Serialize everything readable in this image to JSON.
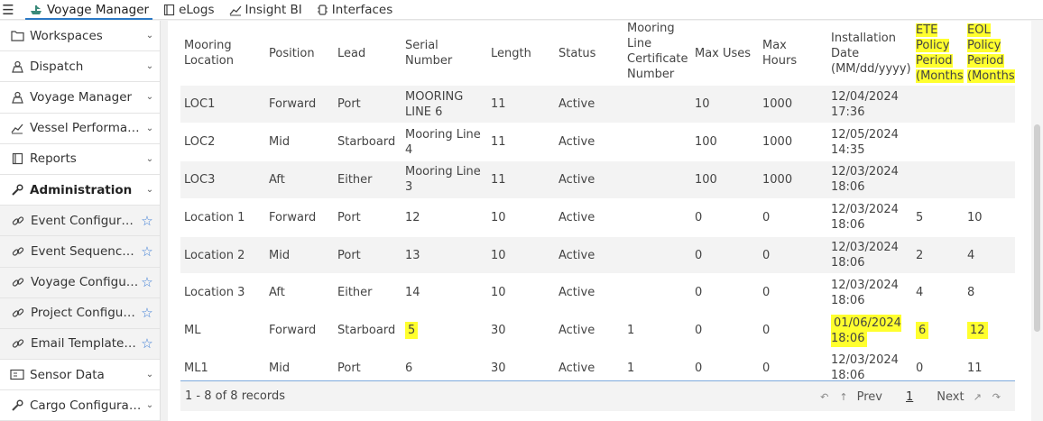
{
  "topbar": {
    "tabs": [
      {
        "label": "Voyage Manager",
        "icon": "ship-icon"
      },
      {
        "label": "eLogs",
        "icon": "book-icon"
      },
      {
        "label": "Insight BI",
        "icon": "chart-icon"
      },
      {
        "label": "Interfaces",
        "icon": "interfaces-icon"
      }
    ]
  },
  "sidebar": {
    "items": [
      {
        "label": "Workspaces"
      },
      {
        "label": "Dispatch"
      },
      {
        "label": "Voyage Manager"
      },
      {
        "label": "Vessel Performance"
      },
      {
        "label": "Reports"
      },
      {
        "label": "Administration"
      },
      {
        "label": "Event Configuration"
      },
      {
        "label": "Event Sequence Configuration"
      },
      {
        "label": "Voyage Configuration"
      },
      {
        "label": "Project Configuration"
      },
      {
        "label": "Email Template Configuration"
      },
      {
        "label": "Sensor Data"
      },
      {
        "label": "Cargo Configuration"
      }
    ]
  },
  "table": {
    "columns": [
      "Mooring Location",
      "Position",
      "Lead",
      "Serial Number",
      "Length",
      "Status",
      "Mooring Line Certificate Number",
      "Max Uses",
      "Max Hours",
      "Installation Date (MM/dd/yyyy)",
      "ETE Policy Period (Months)",
      "EOL Policy Period (Months)"
    ],
    "rows": [
      [
        "LOC1",
        "Forward",
        "Port",
        "MOORING LINE 6",
        "11",
        "Active",
        "",
        "10",
        "1000",
        "12/04/2024 17:36",
        "",
        ""
      ],
      [
        "LOC2",
        "Mid",
        "Starboard",
        "Mooring Line 4",
        "11",
        "Active",
        "",
        "100",
        "1000",
        "12/05/2024 14:35",
        "",
        ""
      ],
      [
        "LOC3",
        "Aft",
        "Either",
        "Mooring Line 3",
        "11",
        "Active",
        "",
        "100",
        "1000",
        "12/03/2024 18:06",
        "",
        ""
      ],
      [
        "Location 1",
        "Forward",
        "Port",
        "12",
        "10",
        "Active",
        "",
        "0",
        "0",
        "12/03/2024 18:06",
        "5",
        "10"
      ],
      [
        "Location 2",
        "Mid",
        "Port",
        "13",
        "10",
        "Active",
        "",
        "0",
        "0",
        "12/03/2024 18:06",
        "2",
        "4"
      ],
      [
        "Location 3",
        "Aft",
        "Either",
        "14",
        "10",
        "Active",
        "",
        "0",
        "0",
        "12/03/2024 18:06",
        "4",
        "8"
      ],
      [
        "ML",
        "Forward",
        "Starboard",
        "5",
        "30",
        "Active",
        "1",
        "0",
        "0",
        "01/06/2024 18:06",
        "6",
        "12"
      ],
      [
        "ML1",
        "Mid",
        "Port",
        "6",
        "30",
        "Active",
        "1",
        "0",
        "0",
        "12/03/2024 18:06",
        "0",
        "11"
      ]
    ]
  },
  "footer": {
    "record_count": "1 - 8 of 8 records",
    "prev_label": "Prev",
    "current_page": "1",
    "next_label": "Next"
  },
  "colors": {
    "highlight": "#ffff2e",
    "accent": "#2a78c5",
    "star": "#3a7bd5"
  }
}
